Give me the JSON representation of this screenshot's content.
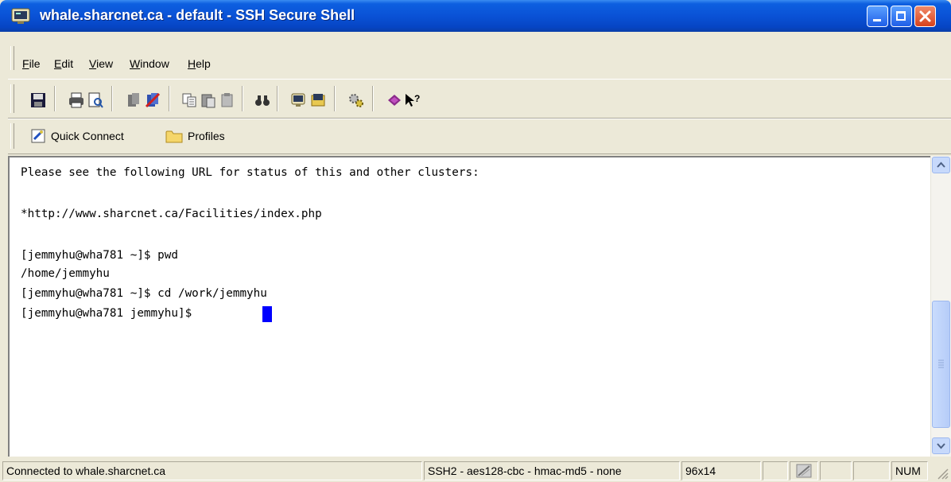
{
  "window": {
    "title": "whale.sharcnet.ca - default - SSH Secure Shell",
    "icon": "terminal-app-icon"
  },
  "menu": {
    "items": [
      "File",
      "Edit",
      "View",
      "Window",
      "Help"
    ]
  },
  "toolbar": {
    "icons": [
      "save-icon",
      "print-icon",
      "print-preview-icon",
      "disconnect-icon",
      "connect-icon",
      "copy-icon",
      "paste-icon",
      "paste-alt-icon",
      "find-icon",
      "new-terminal-icon",
      "new-file-transfer-icon",
      "settings-icon",
      "help-topics-icon",
      "whats-this-icon"
    ]
  },
  "quickbar": {
    "quick_connect": "Quick Connect",
    "profiles": "Profiles"
  },
  "terminal": {
    "lines": [
      "Please see the following URL for status of this and other clusters:",
      "",
      "*http://www.sharcnet.ca/Facilities/index.php",
      "",
      "[jemmyhu@wha781 ~]$ pwd",
      "/home/jemmyhu",
      "[jemmyhu@wha781 ~]$ cd /work/jemmyhu",
      "[jemmyhu@wha781 jemmyhu]$"
    ],
    "cursor_color": "#0000ff"
  },
  "status": {
    "connection": "Connected to whale.sharcnet.ca",
    "protocol": "SSH2 - aes128-cbc - hmac-md5 - none",
    "size": "96x14",
    "num": "NUM"
  },
  "colors": {
    "titlebar": "#0a52d6",
    "chrome": "#ece9d8"
  }
}
